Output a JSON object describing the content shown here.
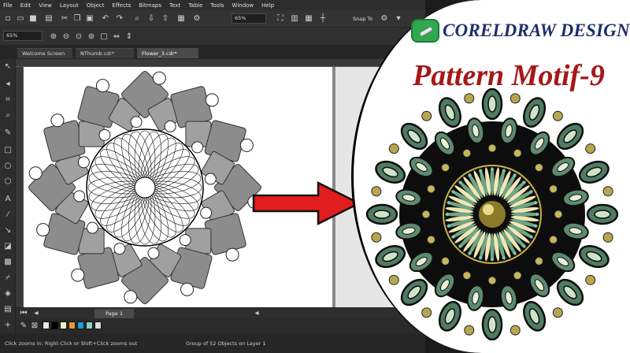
{
  "app": {
    "menu": [
      "File",
      "Edit",
      "View",
      "Layout",
      "Object",
      "Effects",
      "Bitmaps",
      "Text",
      "Table",
      "Tools",
      "Window",
      "Help"
    ],
    "toolbar": {
      "zoom_value": "65%",
      "snap_label": "Snap To"
    },
    "property_bar": {
      "zoom_value": "65%"
    },
    "tabs": [
      "Welcome Screen",
      "NThumb.cdr*",
      "Flower_3.cdr*"
    ],
    "active_tab": "Flower_3.cdr*",
    "page_tab": "Page 1",
    "status_left": "Click zooms in; Right-Click or Shift+Click zooms out",
    "status_right": "Group of 52 Objects on Layer 1",
    "palette_colors": [
      "#e8e8e8",
      "#000000",
      "#f4e9c8",
      "#e79b2c",
      "#1f9ed8",
      "#8fd3c8",
      "#d9d9d9"
    ]
  },
  "thumbnail": {
    "brand": "CORELDRAW DESIGN",
    "title": "Pattern Motif-9",
    "accent_colors": {
      "brand_text": "#1d2f6b",
      "title_text": "#a51818",
      "logo": "#2fa84f",
      "arrow": "#e11d1d"
    },
    "icons": {
      "logo": "coreldraw-logo-icon",
      "arrow": "right-arrow-icon"
    }
  }
}
